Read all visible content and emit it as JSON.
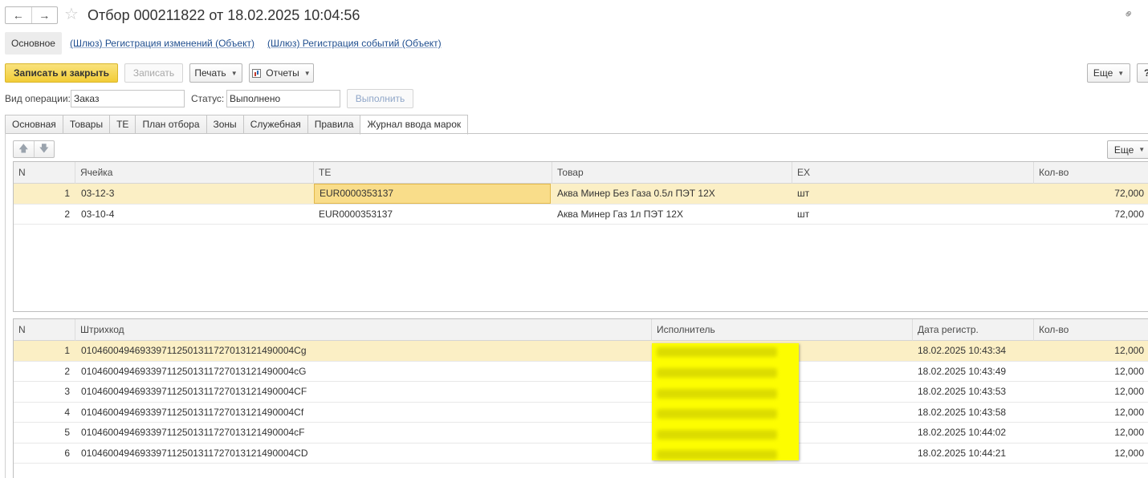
{
  "window": {
    "title": "Отбор 000211822 от 18.02.2025 10:04:56"
  },
  "subnav": {
    "active": "Основное",
    "links": [
      "(Шлюз) Регистрация изменений (Объект)",
      "(Шлюз) Регистрация событий (Объект)"
    ]
  },
  "toolbar": {
    "save_close": "Записать и закрыть",
    "save": "Записать",
    "print": "Печать",
    "reports": "Отчеты",
    "more": "Еще",
    "help": "?"
  },
  "fields": {
    "op_type_label": "Вид операции:",
    "op_type_value": "Заказ",
    "status_label": "Статус:",
    "status_value": "Выполнено",
    "execute_button": "Выполнить"
  },
  "tabs": [
    "Основная",
    "Товары",
    "ТЕ",
    "План отбора",
    "Зоны",
    "Служебная",
    "Правила",
    "Журнал ввода марок"
  ],
  "active_tab": "Журнал ввода марок",
  "table1": {
    "more": "Еще",
    "columns": [
      "N",
      "Ячейка",
      "ТЕ",
      "Товар",
      "ЕХ",
      "Кол-во"
    ],
    "rows": [
      {
        "n": "1",
        "cell": "03-12-3",
        "te": "EUR0000353137",
        "item": "Аква Минер Без Газа 0.5л ПЭТ 12Х",
        "unit": "шт",
        "qty": "72,000"
      },
      {
        "n": "2",
        "cell": "03-10-4",
        "te": "EUR0000353137",
        "item": "Аква Минер Газ 1л ПЭТ 12Х",
        "unit": "шт",
        "qty": "72,000"
      }
    ]
  },
  "table2": {
    "columns": [
      "N",
      "Штрихкод",
      "Исполнитель",
      "Дата регистр.",
      "Кол-во"
    ],
    "rows": [
      {
        "n": "1",
        "barcode": "0104600494693397112501311727013121490004Cg",
        "date": "18.02.2025 10:43:34",
        "qty": "12,000"
      },
      {
        "n": "2",
        "barcode": "0104600494693397112501311727013121490004cG",
        "date": "18.02.2025 10:43:49",
        "qty": "12,000"
      },
      {
        "n": "3",
        "barcode": "0104600494693397112501311727013121490004CF",
        "date": "18.02.2025 10:43:53",
        "qty": "12,000"
      },
      {
        "n": "4",
        "barcode": "0104600494693397112501311727013121490004Cf",
        "date": "18.02.2025 10:43:58",
        "qty": "12,000"
      },
      {
        "n": "5",
        "barcode": "0104600494693397112501311727013121490004cF",
        "date": "18.02.2025 10:44:02",
        "qty": "12,000"
      },
      {
        "n": "6",
        "barcode": "0104600494693397112501311727013121490004CD",
        "date": "18.02.2025 10:44:21",
        "qty": "12,000"
      }
    ]
  },
  "colors": {
    "accent_button": "#f2cd37",
    "selected_row": "#fbefc5",
    "highlight": "#fdfd00",
    "link": "#1f4e8f"
  }
}
